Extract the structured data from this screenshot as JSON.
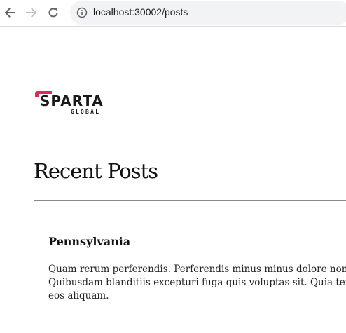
{
  "browser": {
    "url": "localhost:30002/posts",
    "back_icon": "back-arrow-icon",
    "forward_icon": "forward-arrow-icon",
    "reload_icon": "reload-icon",
    "info_icon": "info-icon"
  },
  "logo": {
    "word": "SPARTA",
    "sub": "GLOBAL",
    "accent_color": "#e5265a"
  },
  "page": {
    "title": "Recent Posts"
  },
  "posts": [
    {
      "title": "Pennsylvania",
      "body_lines": [
        "Quam rerum perferendis. Perferendis minus minus dolore non sed v",
        "Quibusdam blanditiis excepturi fuga quis voluptas sit. Quia tenetur",
        "eos aliquam."
      ]
    }
  ]
}
